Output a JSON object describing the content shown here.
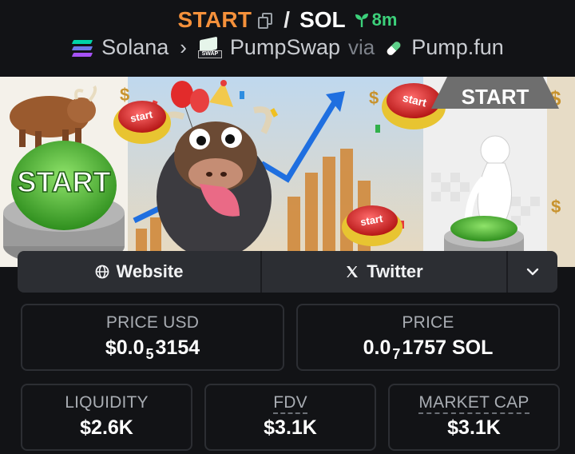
{
  "pair": {
    "base_symbol": "START",
    "separator": "/",
    "quote_symbol": "SOL",
    "age": "8m"
  },
  "route": {
    "chain": "Solana",
    "dex": "PumpSwap",
    "dex_logo_text": "SWAP",
    "via_label": "via",
    "launchpad": "Pump.fun"
  },
  "banner": {
    "button_text": "START",
    "sign_text": "START",
    "disc_text": "start"
  },
  "links": {
    "website_label": "Website",
    "twitter_label": "Twitter",
    "more_icon": "chevron-down-icon"
  },
  "stats": {
    "price_usd": {
      "label": "PRICE USD",
      "prefix": "$0.0",
      "zeros": "5",
      "digits": "3154"
    },
    "price_native": {
      "label": "PRICE",
      "prefix": "0.0",
      "zeros": "7",
      "digits": "1757 SOL"
    },
    "liquidity": {
      "label": "LIQUIDITY",
      "value": "$2.6K"
    },
    "fdv": {
      "label": "FDV",
      "value": "$3.1K"
    },
    "market_cap": {
      "label": "MARKET CAP",
      "value": "$3.1K"
    }
  },
  "colors": {
    "base_symbol": "#f5913b",
    "age": "#3cd07a",
    "background": "#121316",
    "card_border": "#2c2e33"
  }
}
